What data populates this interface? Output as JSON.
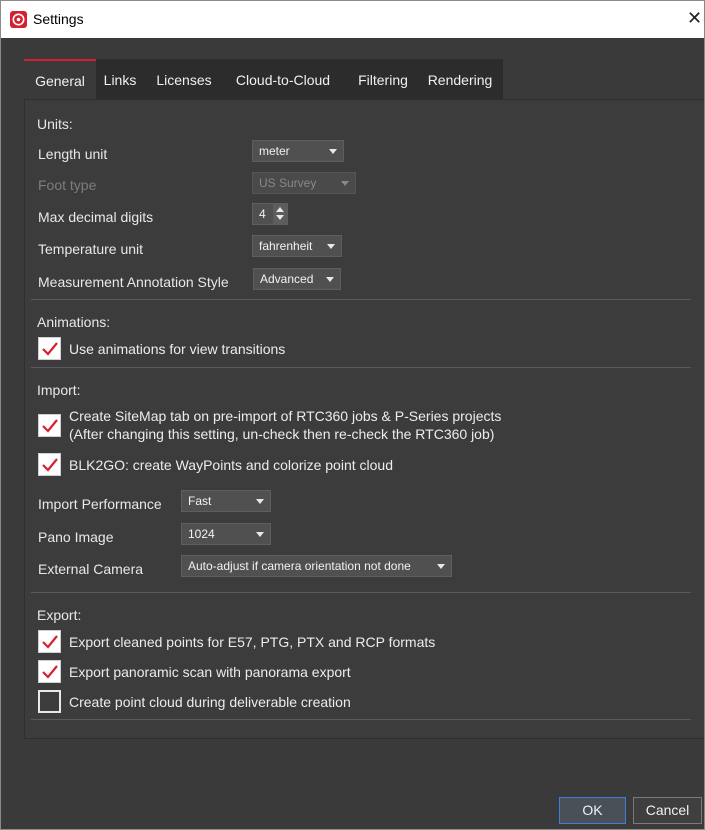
{
  "window": {
    "title": "Settings",
    "close_glyph": "✕",
    "icon": "leica-app-icon"
  },
  "tabs": [
    {
      "label": "General",
      "active": true
    },
    {
      "label": "Links",
      "active": false
    },
    {
      "label": "Licenses",
      "active": false
    },
    {
      "label": "Cloud-to-Cloud",
      "active": false
    },
    {
      "label": "Filtering",
      "active": false
    },
    {
      "label": "Rendering",
      "active": false
    }
  ],
  "units": {
    "title": "Units:",
    "length_label": "Length unit",
    "length_value": "meter",
    "foot_label": "Foot type",
    "foot_value": "US Survey",
    "decimal_label": "Max decimal digits",
    "decimal_value": "4",
    "temperature_label": "Temperature unit",
    "temperature_value": "fahrenheit",
    "annotation_label": "Measurement Annotation Style",
    "annotation_value": "Advanced"
  },
  "animations": {
    "title": "Animations:",
    "view_transitions": {
      "label": "Use animations for view transitions",
      "checked": true
    }
  },
  "import": {
    "title": "Import:",
    "sitemap": {
      "label_line1": "Create SiteMap tab on pre-import of RTC360 jobs & P-Series projects",
      "label_line2": "(After changing this setting, un-check then re-check the RTC360 job)",
      "checked": true
    },
    "blk2go": {
      "label": "BLK2GO: create WayPoints and colorize point cloud",
      "checked": true
    },
    "performance_label": "Import Performance",
    "performance_value": "Fast",
    "pano_label": "Pano Image",
    "pano_value": "1024",
    "camera_label": "External Camera",
    "camera_value": "Auto-adjust if camera orientation not done"
  },
  "export": {
    "title": "Export:",
    "cleaned_points": {
      "label": "Export cleaned points for E57, PTG, PTX and RCP formats",
      "checked": true
    },
    "panoramic": {
      "label": "Export panoramic scan with panorama export",
      "checked": true
    },
    "point_cloud": {
      "label": "Create point cloud during deliverable creation",
      "checked": false
    }
  },
  "buttons": {
    "ok": "OK",
    "cancel": "Cancel"
  },
  "colors": {
    "accent_red": "#d5212e",
    "panel_bg": "#3c3c3c",
    "check_mark": "#d5212e",
    "ok_border": "#3b7fd8"
  }
}
